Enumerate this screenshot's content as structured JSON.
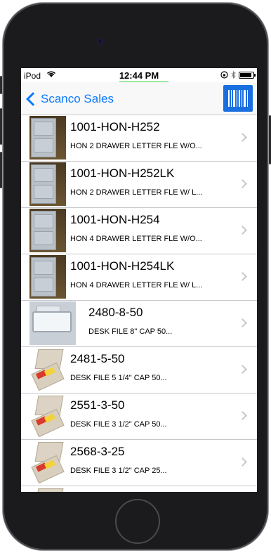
{
  "status_bar": {
    "carrier": "iPod",
    "time": "12:44 PM",
    "connection": "connected"
  },
  "nav": {
    "back_label": "Scanco Sales"
  },
  "items": [
    {
      "sku": "1001-HON-H252",
      "description": "HON 2 DRAWER LETTER FLE W/O...",
      "thumb": "cabinet"
    },
    {
      "sku": "1001-HON-H252LK",
      "description": "HON 2 DRAWER LETTER FLE W/ L...",
      "thumb": "cabinet"
    },
    {
      "sku": "1001-HON-H254",
      "description": "HON 4 DRAWER LETTER FLE W/O...",
      "thumb": "cabinet"
    },
    {
      "sku": "1001-HON-H254LK",
      "description": "HON 4 DRAWER LETTER FLE W/ L...",
      "thumb": "cabinet"
    },
    {
      "sku": "2480-8-50",
      "description": "DESK FILE 8\" CAP 50...",
      "thumb": "tray"
    },
    {
      "sku": "2481-5-50",
      "description": "DESK FILE 5 1/4\" CAP 50...",
      "thumb": "box"
    },
    {
      "sku": "2551-3-50",
      "description": "DESK FILE 3 1/2\" CAP 50...",
      "thumb": "box"
    },
    {
      "sku": "2568-3-25",
      "description": "DESK FILE 3 1/2\" CAP 25...",
      "thumb": "box"
    }
  ]
}
